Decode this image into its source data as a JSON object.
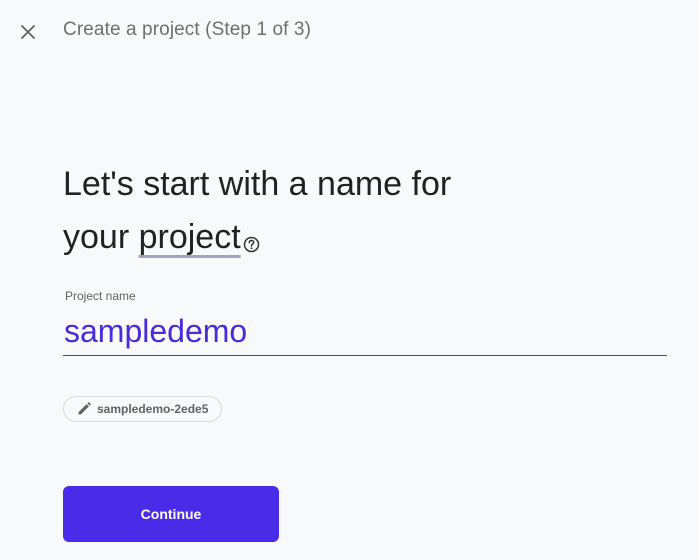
{
  "header": {
    "close_icon": "close-icon",
    "title": "Create a project (Step 1 of 3)"
  },
  "main": {
    "heading_line1": "Let's start with a name for",
    "heading_line2_prefix": "your ",
    "heading_project_word": "project",
    "help_icon": "help-circle-icon",
    "project_name": {
      "label": "Project name",
      "value": "sampledemo"
    },
    "project_id": {
      "icon": "pencil-icon",
      "value": "sampledemo-2ede5"
    },
    "continue_label": "Continue"
  },
  "colors": {
    "accent": "#4a2be8",
    "input_text": "#4a2bd8",
    "background": "#f8f9fb"
  }
}
